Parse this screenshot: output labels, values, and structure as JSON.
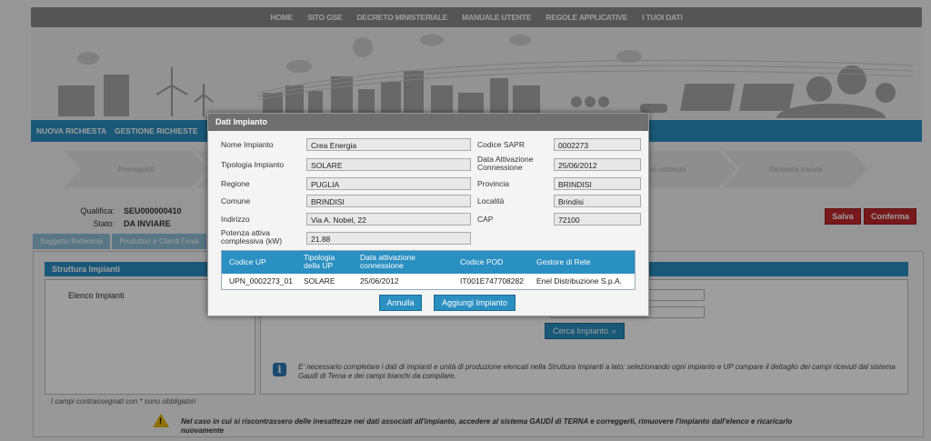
{
  "topnav": [
    "HOME",
    "SITO GSE",
    "DECRETO MINISTERIALE",
    "MANUALE UTENTE",
    "REGOLE APPLICATIVE",
    "I TUOI DATI"
  ],
  "bluebar": {
    "nuova": "NUOVA RICHIESTA",
    "gestione": "GESTIONE RICHIESTE"
  },
  "steps": [
    "Prerequisiti",
    "",
    "",
    "",
    "Invio richiesta",
    "Richiesta inviata"
  ],
  "qualifica": {
    "label_qualifica": "Qualifica:",
    "value_qualifica": "SEU000000410",
    "label_stato": "Stato:",
    "value_stato": "DA INVIARE"
  },
  "actions": {
    "salva": "Salva",
    "conferma": "Conferma"
  },
  "tabs": [
    "Soggetto Referente",
    "Produttori e Clienti Finali"
  ],
  "struttura": {
    "title": "Struttura Impianti",
    "elenco": "Elenco Impianti"
  },
  "cerca_label": "Cerca Impianto",
  "cerca_icon": "search-icon",
  "info_text": "E' necessario completare i dati di impianti e unità di produzione elencati nella Struttura Impianti a lato: selezionando ogni impianto e UP compare il dettaglio dei campi ricevuti dal sistema Gaudì di Terna e dei campi bianchi da compilare.",
  "oblig_text": "I campi contrassegnati con * sono obbligatori",
  "warn_text": "Nel caso in cui si riscontrassero delle inesattezze nei dati associati all'impianto, accedere al sistema GAUDÌ di TERNA e correggerli, rimuovere l'impianto dall'elenco e ricaricarlo nuovamente",
  "modal": {
    "title": "Dati Impianto",
    "fields": {
      "nome_label": "Nome Impianto",
      "nome": "Crea Energia",
      "sapr_label": "Codice SAPR",
      "sapr": "0002273",
      "tipologia_label": "Tipologia Impianto",
      "tipologia": "SOLARE",
      "data_att_label": "Data Attivazione Connessione",
      "data_att": "25/06/2012",
      "regione_label": "Regione",
      "regione": "PUGLIA",
      "provincia_label": "Provincia",
      "provincia": "BRINDISI",
      "comune_label": "Comune",
      "comune": "BRINDISI",
      "localita_label": "Località",
      "localita": "Brindisi",
      "indirizzo_label": "Indirizzo",
      "indirizzo": "Via A. Nobel, 22",
      "cap_label": "CAP",
      "cap": "72100",
      "potenza_label": "Potenza attiva complessiva (kW)",
      "potenza": "21.88"
    },
    "table": {
      "headers": [
        "Codice UP",
        "Tipologia della UP",
        "Data attivazione connessione",
        "Codice POD",
        "Gestore di Rete"
      ],
      "rows": [
        [
          "UPN_0002273_01",
          "SOLARE",
          "25/06/2012",
          "IT001E747708282",
          "Enel Distribuzione S.p.A."
        ]
      ]
    },
    "annulla": "Annulla",
    "aggiungi": "Aggiungi Impianto"
  }
}
